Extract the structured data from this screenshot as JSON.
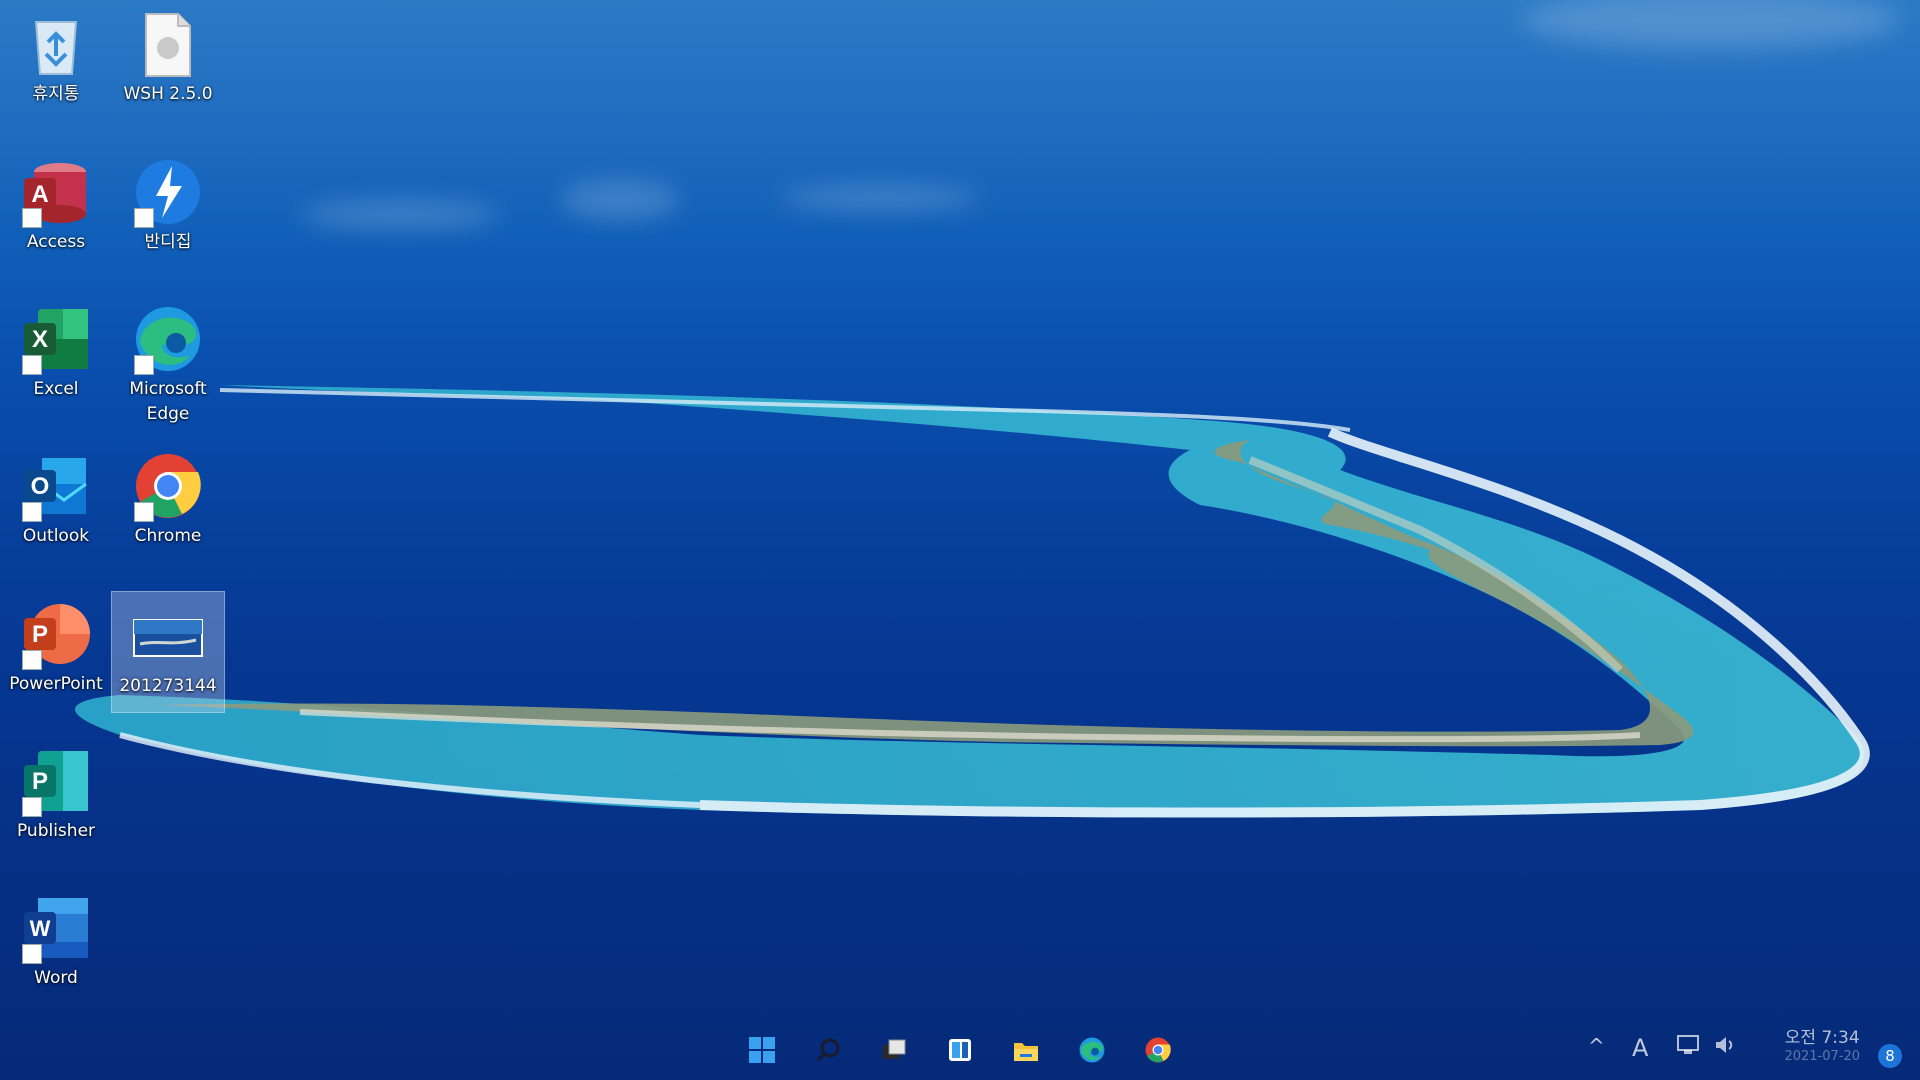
{
  "desktop": {
    "icons": [
      {
        "label": "휴지통",
        "icon": "recycle-bin-icon",
        "color": "#5fa8e0"
      },
      {
        "label": "WSH 2.5.0",
        "icon": "file-icon",
        "color": "#f2f2f2"
      },
      {
        "label": "Access",
        "icon": "access-icon",
        "color": "#c4314b"
      },
      {
        "label": "반디집",
        "icon": "bandizip-icon",
        "color": "#1e7be0"
      },
      {
        "label": "Excel",
        "icon": "excel-icon",
        "color": "#107c41"
      },
      {
        "label": "Microsoft Edge",
        "icon": "edge-icon",
        "color": "#1f9ae0"
      },
      {
        "label": "Outlook",
        "icon": "outlook-icon",
        "color": "#0f6cbd"
      },
      {
        "label": "Chrome",
        "icon": "chrome-icon",
        "color": "#e34133"
      },
      {
        "label": "PowerPoint",
        "icon": "powerpoint-icon",
        "color": "#c43e1c"
      },
      {
        "label": "201273144",
        "icon": "image-file-icon",
        "color": "#1a4fa0"
      },
      {
        "label": "Publisher",
        "icon": "publisher-icon",
        "color": "#077568"
      },
      {
        "label": "Word",
        "icon": "word-icon",
        "color": "#185abd"
      }
    ]
  },
  "taskbar": {
    "apps": [
      "start-icon",
      "search-icon",
      "task-view-icon",
      "widgets-icon",
      "file-explorer-icon",
      "edge-icon",
      "chrome-icon"
    ],
    "tray": {
      "chevron": "^",
      "ime": "A",
      "clock_period": "오전 7:34",
      "clock_date": "2021-07-20",
      "notifications": "8"
    }
  }
}
